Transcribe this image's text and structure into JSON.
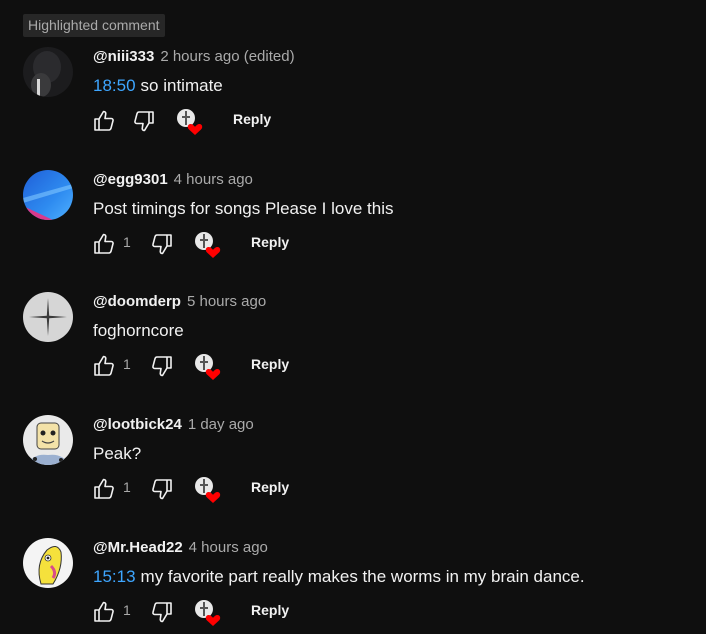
{
  "highlight_label": "Highlighted comment",
  "colors": {
    "background": "#0f0f0f",
    "timestamp_link": "#3ea6ff",
    "heart": "#ff0000",
    "muted_text": "#aaaaaa"
  },
  "comments": [
    {
      "author": "@niii333",
      "time": "2 hours ago (edited)",
      "timestamp_link": "18:50",
      "text": "so intimate",
      "like_count": "",
      "reply_label": "Reply",
      "avatar": "dark-figure-avatar"
    },
    {
      "author": "@egg9301",
      "time": "4 hours ago",
      "timestamp_link": "",
      "text": "Post timings for songs Please I love this",
      "like_count": "1",
      "reply_label": "Reply",
      "avatar": "blue-gradient-avatar"
    },
    {
      "author": "@doomderp",
      "time": "5 hours ago",
      "timestamp_link": "",
      "text": "foghorncore",
      "like_count": "1",
      "reply_label": "Reply",
      "avatar": "gray-cross-avatar"
    },
    {
      "author": "@lootbick24",
      "time": "1 day ago",
      "timestamp_link": "",
      "text": "Peak?",
      "like_count": "1",
      "reply_label": "Reply",
      "avatar": "cartoon-face-avatar"
    },
    {
      "author": "@Mr.Head22",
      "time": "4 hours ago",
      "timestamp_link": "15:13",
      "text": "my favorite part really makes the worms in my brain dance.",
      "like_count": "1",
      "reply_label": "Reply",
      "avatar": "yellow-cartoon-avatar"
    }
  ]
}
